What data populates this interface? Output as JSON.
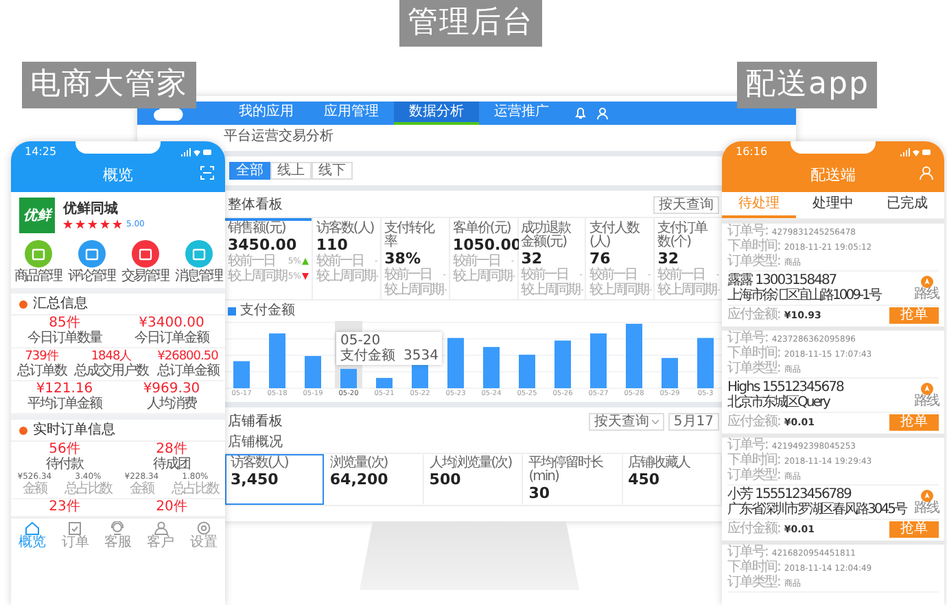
{
  "captions": [
    "电商大管家",
    "管理后台",
    "配送app"
  ],
  "merchant_app": {
    "status_time": "14:25",
    "title": "概览",
    "store": {
      "logo_text": "优鲜",
      "name": "优鲜同城",
      "stars": 5,
      "rating": "5.00"
    },
    "shortcuts": [
      {
        "label": "商品管理",
        "color": "#6cc12b"
      },
      {
        "label": "评论管理",
        "color": "#2d9cf0"
      },
      {
        "label": "交易管理",
        "color": "#f5333f"
      },
      {
        "label": "消息管理",
        "color": "#1dbcd8"
      }
    ],
    "summary": {
      "title": "汇总信息",
      "rows": [
        [
          {
            "value": "85件",
            "label": "今日订单数量"
          },
          {
            "value": "¥3400.00",
            "label": "今日订单金额"
          }
        ],
        [
          {
            "value": "739件",
            "label": "总订单数"
          },
          {
            "value": "1848人",
            "label": "总成交用户数"
          },
          {
            "value": "¥26800.50",
            "label": "总订单金额"
          }
        ],
        [
          {
            "value": "¥121.16",
            "label": "平均订单金额"
          },
          {
            "value": "¥969.30",
            "label": "人均消费"
          }
        ]
      ]
    },
    "realtime": {
      "title": "实时订单信息",
      "cards": [
        {
          "count": "56件",
          "status": "待付款",
          "amount": "¥526.34",
          "amount_label": "金额",
          "ratio": "3.40%",
          "ratio_label": "总占比数"
        },
        {
          "count": "28件",
          "status": "待成团",
          "amount": "¥228.34",
          "amount_label": "金额",
          "ratio": "1.80%",
          "ratio_label": "总占比数"
        }
      ],
      "more": [
        "23件",
        "20件"
      ]
    },
    "tab_bar": [
      {
        "label": "概览",
        "selected": true
      },
      {
        "label": "订单",
        "selected": false
      },
      {
        "label": "客服",
        "selected": false
      },
      {
        "label": "客户",
        "selected": false
      },
      {
        "label": "设置",
        "selected": false
      }
    ]
  },
  "admin": {
    "nav": [
      {
        "label": "我的应用",
        "selected": false
      },
      {
        "label": "应用管理",
        "selected": false
      },
      {
        "label": "数据分析",
        "selected": true
      },
      {
        "label": "运营推广",
        "selected": false
      }
    ],
    "breadcrumb": "平台运营交易分析",
    "channel_tabs": [
      {
        "label": "全部",
        "selected": true
      },
      {
        "label": "线上",
        "selected": false
      },
      {
        "label": "线下",
        "selected": false
      }
    ],
    "overview": {
      "title": "整体看板",
      "query_button": "按天查询",
      "kpis": [
        {
          "label": "销售额(元)",
          "value": "3450.00",
          "selected": true,
          "comparisons": [
            {
              "label": "较前一日",
              "change": "5%",
              "kind": "up"
            },
            {
              "label": "较上周同期",
              "change": "5%",
              "kind": "down"
            }
          ]
        },
        {
          "label": "访客数(人)",
          "value": "110",
          "selected": false,
          "comparisons": [
            {
              "label": "较前一日",
              "change": "-",
              "kind": "flat"
            },
            {
              "label": "较上周同期",
              "change": "-",
              "kind": "flat"
            }
          ]
        },
        {
          "label": "支付转化率",
          "value": "38%",
          "selected": false,
          "comparisons": [
            {
              "label": "较前一日",
              "change": "-",
              "kind": "flat"
            },
            {
              "label": "较上周同期",
              "change": "-",
              "kind": "flat"
            }
          ]
        },
        {
          "label": "客单价(元)",
          "value": "1050.00",
          "selected": false,
          "comparisons": [
            {
              "label": "较前一日",
              "change": "-",
              "kind": "flat"
            },
            {
              "label": "较上周同期",
              "change": "-",
              "kind": "flat"
            }
          ]
        },
        {
          "label": "成功退款金额(元)",
          "value": "32",
          "selected": false,
          "comparisons": [
            {
              "label": "较前一日",
              "change": "-",
              "kind": "flat"
            },
            {
              "label": "较上周同期",
              "change": "-",
              "kind": "flat"
            }
          ]
        },
        {
          "label": "支付人数(人)",
          "value": "76",
          "selected": false,
          "comparisons": [
            {
              "label": "较前一日",
              "change": "-",
              "kind": "flat"
            },
            {
              "label": "较上周同期",
              "change": "-",
              "kind": "flat"
            }
          ]
        },
        {
          "label": "支付订单数(个)",
          "value": "32",
          "selected": false,
          "comparisons": [
            {
              "label": "较前一日",
              "change": "-",
              "kind": "flat"
            },
            {
              "label": "较上周同期",
              "change": "-",
              "kind": "flat"
            }
          ]
        }
      ],
      "legend": "支付金额",
      "dates": [
        {
          "label": "05-17",
          "selected": false
        },
        {
          "label": "05-18",
          "selected": false
        },
        {
          "label": "05-19",
          "selected": false
        },
        {
          "label": "05-20",
          "selected": true
        },
        {
          "label": "05-21",
          "selected": false
        },
        {
          "label": "05-22",
          "selected": false
        },
        {
          "label": "05-23",
          "selected": false
        },
        {
          "label": "05-24",
          "selected": false
        },
        {
          "label": "05-25",
          "selected": false
        },
        {
          "label": "05-26",
          "selected": false
        },
        {
          "label": "05-27",
          "selected": false
        },
        {
          "label": "05-28",
          "selected": false
        },
        {
          "label": "05-29",
          "selected": false
        },
        {
          "label": "05-3",
          "selected": false
        }
      ],
      "tooltip": {
        "date": "05-20",
        "label": "支付金额",
        "value": "3534"
      }
    },
    "store": {
      "title": "店铺看板",
      "query_select": "按天查询",
      "date_field": "5月17",
      "subtitle": "店铺概况",
      "stats": [
        {
          "label": "访客数(人)",
          "value": "3,450",
          "selected": true
        },
        {
          "label": "浏览量(次)",
          "value": "64,200",
          "selected": false
        },
        {
          "label": "人均浏览量(次)",
          "value": "500",
          "selected": false
        },
        {
          "label": "平均停留时长(min)",
          "value": "30",
          "selected": false
        },
        {
          "label": "店铺收藏人",
          "value": "450",
          "selected": false
        }
      ]
    }
  },
  "delivery_app": {
    "status_time": "16:16",
    "title": "配送端",
    "tabs": [
      {
        "label": "待处理",
        "selected": true
      },
      {
        "label": "处理中",
        "selected": false
      },
      {
        "label": "已完成",
        "selected": false
      }
    ],
    "orders": [
      {
        "meta": [
          {
            "label": "订单号:",
            "value": "4279831245256478"
          },
          {
            "label": "下单时间:",
            "value": "2018-11-21 19:05:12"
          },
          {
            "label": "订单类型:",
            "value": "商品"
          }
        ],
        "contact": "露露 13003158487",
        "address": "上海市徐汇区宜山路1009-1号",
        "route_label": "路线",
        "amount_label": "应付金额:",
        "amount": "¥10.93",
        "action": "抢单"
      },
      {
        "meta": [
          {
            "label": "订单号:",
            "value": "4237286362095896"
          },
          {
            "label": "下单时间:",
            "value": "2018-11-15 17:07:43"
          },
          {
            "label": "订单类型:",
            "value": "商品"
          }
        ],
        "contact": "Highs 15512345678",
        "address": "北京市东城区Query",
        "route_label": "路线",
        "amount_label": "应付金额:",
        "amount": "¥0.01",
        "action": "抢单"
      },
      {
        "meta": [
          {
            "label": "订单号:",
            "value": "4219492398045253"
          },
          {
            "label": "下单时间:",
            "value": "2018-11-14 19:29:43"
          },
          {
            "label": "订单类型:",
            "value": "商品"
          }
        ],
        "contact": "小芳 1555123456789",
        "address": "广东省深圳市罗湖区春风路3045号",
        "route_label": "路线",
        "amount_label": "应付金额:",
        "amount": "¥0.01",
        "action": "抢单"
      },
      {
        "meta": [
          {
            "label": "订单号:",
            "value": "4216820954451811"
          },
          {
            "label": "下单时间:",
            "value": "2018-11-14 12:04:49"
          },
          {
            "label": "订单类型:",
            "value": "商品"
          }
        ]
      }
    ]
  }
}
